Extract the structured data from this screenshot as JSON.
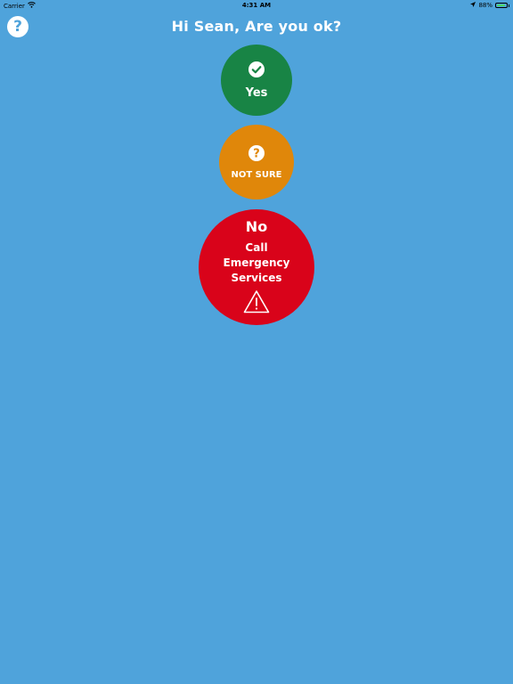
{
  "status_bar": {
    "carrier": "Carrier",
    "time": "4:31 AM",
    "battery_percent": "88%",
    "battery_level": 0.88,
    "battery_color": "#4CD964"
  },
  "header": {
    "help_symbol": "?",
    "title": "Hi Sean, Are you ok?"
  },
  "options": {
    "yes": {
      "label": "Yes",
      "icon": "checkmark-icon",
      "color": "#188445"
    },
    "not_sure": {
      "label": "NOT SURE",
      "icon": "question-icon",
      "icon_symbol": "?",
      "color": "#E0870A"
    },
    "no": {
      "title": "No",
      "line1": "Call",
      "line2": "Emergency",
      "line3": "Services",
      "icon": "warning-icon",
      "color": "#D9031A"
    }
  },
  "colors": {
    "background": "#4FA3DB"
  }
}
